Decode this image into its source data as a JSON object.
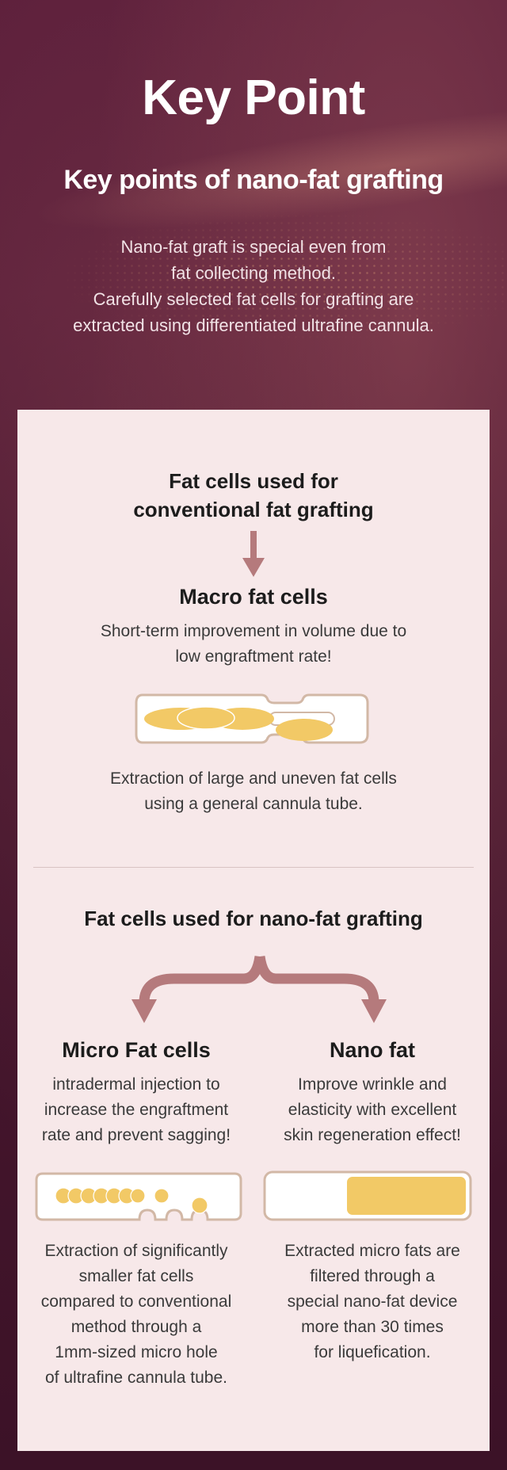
{
  "header": {
    "title": "Key Point",
    "subtitle": "Key points of nano-fat grafting",
    "intro_lines": [
      "Nano-fat graft is special even from",
      "fat collecting method.",
      "Carefully selected fat cells for grafting are",
      "extracted using differentiated ultrafine cannula."
    ]
  },
  "conventional": {
    "heading_lines": [
      "Fat cells used for",
      "conventional fat grafting"
    ],
    "arrow_icon": "arrow-down-icon",
    "cell_title": "Macro fat cells",
    "desc_lines": [
      "Short-term improvement in volume due to",
      "low engraftment rate!"
    ],
    "illustration": "macro-fat-cannula-icon",
    "caption_lines": [
      "Extraction of large and uneven fat cells",
      "using a general cannula tube."
    ]
  },
  "nano": {
    "heading": "Fat cells used for nano-fat grafting",
    "brace_icon": "split-arrow-icon",
    "micro": {
      "title": "Micro Fat cells",
      "desc_lines": [
        "intradermal injection to",
        "increase the engraftment",
        "rate and prevent sagging!"
      ],
      "illustration": "micro-fat-cannula-icon",
      "caption_lines": [
        "Extraction of significantly",
        "smaller fat cells",
        "compared to conventional",
        "method through a",
        "1mm-sized micro hole",
        "of ultrafine cannula tube."
      ]
    },
    "nanofat": {
      "title": "Nano fat",
      "desc_lines": [
        "Improve wrinkle and",
        "elasticity with excellent",
        "skin regeneration effect!"
      ],
      "illustration": "nano-fat-tube-icon",
      "caption_lines": [
        "Extracted micro fats are",
        "filtered through a",
        "special nano-fat device",
        "more than 30 times",
        "for liquefication."
      ]
    }
  },
  "colors": {
    "background": "#4a1830",
    "card": "#f7e8e9",
    "accent_arrow": "#b57a7c",
    "fat_yellow": "#f2c966",
    "tube_border": "#d2b8a6"
  }
}
